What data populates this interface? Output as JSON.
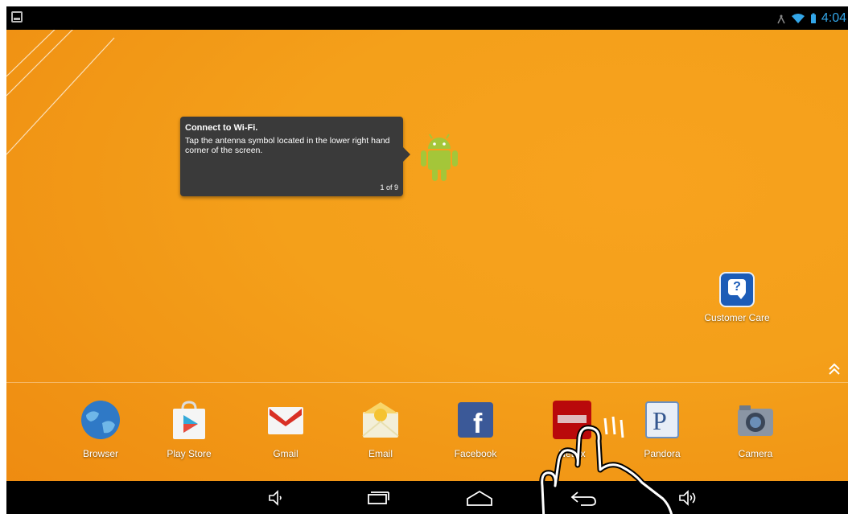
{
  "status_bar": {
    "left_icon": "screenshot-icon",
    "right_icons": [
      "antenna-icon",
      "wifi-icon",
      "battery-icon"
    ],
    "time": "4:04"
  },
  "tooltip": {
    "title": "Connect to Wi-Fi.",
    "body": "Tap the antenna symbol located in the lower right hand corner of the screen.",
    "counter": "1 of 9"
  },
  "desktop": {
    "customer_care_label": "Customer Care"
  },
  "dock": [
    {
      "label": "Browser",
      "icon": "globe-icon"
    },
    {
      "label": "Play Store",
      "icon": "play-store-icon"
    },
    {
      "label": "Gmail",
      "icon": "gmail-icon"
    },
    {
      "label": "Email",
      "icon": "email-icon"
    },
    {
      "label": "Facebook",
      "icon": "facebook-icon"
    },
    {
      "label": "Netflix",
      "icon": "netflix-icon"
    },
    {
      "label": "Pandora",
      "icon": "pandora-icon"
    },
    {
      "label": "Camera",
      "icon": "camera-icon"
    }
  ],
  "nav_bar": [
    "volume-down-icon",
    "recent-apps-icon",
    "home-icon",
    "back-icon",
    "volume-up-icon"
  ],
  "colors": {
    "wallpaper": "#f4a01a",
    "tooltip_bg": "#3a3a3a",
    "accent_blue": "#33a6e8"
  }
}
